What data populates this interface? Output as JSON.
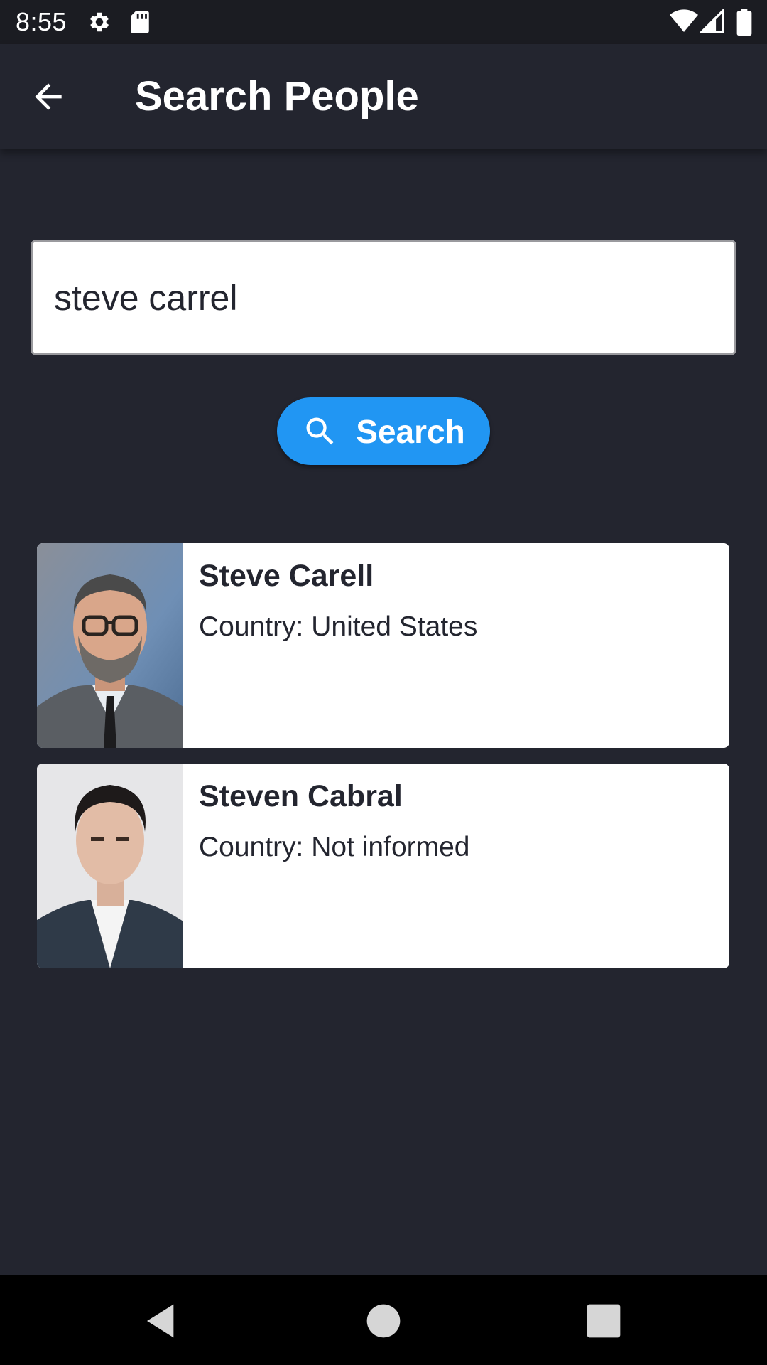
{
  "status_bar": {
    "time": "8:55",
    "icons": [
      "gear-icon",
      "sd-card-icon",
      "wifi-icon",
      "signal-icon",
      "battery-icon"
    ]
  },
  "app_bar": {
    "back_icon": "arrow-back-icon",
    "title": "Search People"
  },
  "search": {
    "query": "steve carrel",
    "button_icon": "search-icon",
    "button_label": "Search"
  },
  "results": [
    {
      "name": "Steve Carell",
      "country": "Country: United States"
    },
    {
      "name": "Steven Cabral",
      "country": "Country: Not informed"
    }
  ],
  "nav_bar": {
    "icons": [
      "back-triangle-icon",
      "home-circle-icon",
      "recents-square-icon"
    ]
  },
  "colors": {
    "background": "#23252f",
    "status_bar": "#1b1c22",
    "accent": "#2196f3",
    "card": "#ffffff",
    "nav_bar": "#000000"
  }
}
